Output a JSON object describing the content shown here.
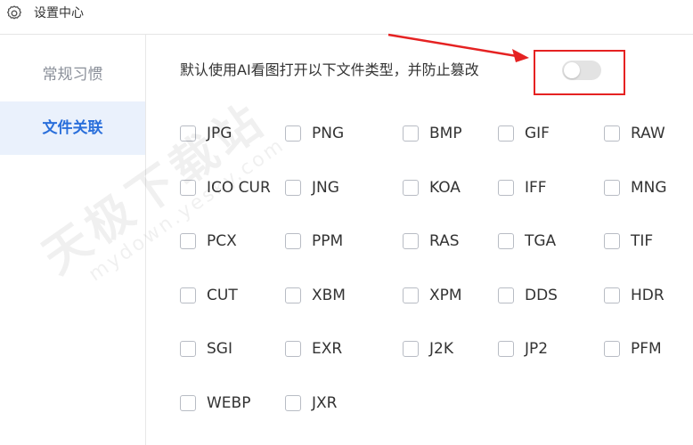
{
  "window": {
    "title": "设置中心",
    "icon": "gear-icon"
  },
  "sidebar": {
    "items": [
      {
        "label": "常规习惯",
        "active": false
      },
      {
        "label": "文件关联",
        "active": true
      }
    ]
  },
  "main": {
    "description": "默认使用AI看图打开以下文件类型，并防止篡改",
    "toggle": {
      "on": false
    },
    "filetypes": [
      {
        "label": "JPG",
        "checked": false
      },
      {
        "label": "PNG",
        "checked": false
      },
      {
        "label": "BMP",
        "checked": false
      },
      {
        "label": "GIF",
        "checked": false
      },
      {
        "label": "RAW",
        "checked": false
      },
      {
        "label": "ICO CUR",
        "checked": false
      },
      {
        "label": "JNG",
        "checked": false
      },
      {
        "label": "KOA",
        "checked": false
      },
      {
        "label": "IFF",
        "checked": false
      },
      {
        "label": "MNG",
        "checked": false
      },
      {
        "label": "PCX",
        "checked": false
      },
      {
        "label": "PPM",
        "checked": false
      },
      {
        "label": "RAS",
        "checked": false
      },
      {
        "label": "TGA",
        "checked": false
      },
      {
        "label": "TIF",
        "checked": false
      },
      {
        "label": "CUT",
        "checked": false
      },
      {
        "label": "XBM",
        "checked": false
      },
      {
        "label": "XPM",
        "checked": false
      },
      {
        "label": "DDS",
        "checked": false
      },
      {
        "label": "HDR",
        "checked": false
      },
      {
        "label": "SGI",
        "checked": false
      },
      {
        "label": "EXR",
        "checked": false
      },
      {
        "label": "J2K",
        "checked": false
      },
      {
        "label": "JP2",
        "checked": false
      },
      {
        "label": "PFM",
        "checked": false
      },
      {
        "label": "WEBP",
        "checked": false
      },
      {
        "label": "JXR",
        "checked": false
      }
    ]
  },
  "watermark": {
    "line1": "天极下载站",
    "line2": "mydown.yesky.com"
  },
  "colors": {
    "accent": "#2a6fdb",
    "active_bg": "#eaf1fc",
    "annotation_red": "#e52222"
  }
}
